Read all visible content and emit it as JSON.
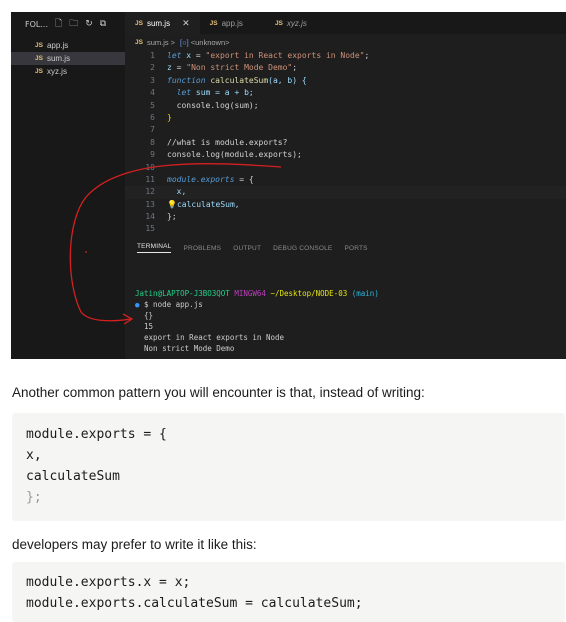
{
  "sidebar": {
    "title": "FOL...",
    "files": [
      {
        "name": "app.js",
        "active": false
      },
      {
        "name": "sum.js",
        "active": true
      },
      {
        "name": "xyz.js",
        "active": false
      }
    ]
  },
  "editor": {
    "tabs": [
      {
        "name": "sum.js",
        "active": true,
        "italic": false
      },
      {
        "name": "app.js",
        "active": false,
        "italic": false
      },
      {
        "name": "xyz.js",
        "active": false,
        "italic": true
      }
    ],
    "breadcrumb": {
      "file": "sum.js",
      "sep": ">",
      "symbol": "<unknown>"
    },
    "line_numbers": [
      "1",
      "2",
      "3",
      "4",
      "5",
      "6",
      "7",
      "8",
      "9",
      "10",
      "11",
      "12",
      "13",
      "14",
      "15"
    ],
    "lines": {
      "l1_kw": "let",
      "l1_var": " x ",
      "l1_op": "= ",
      "l1_str": "\"export in React exports in Node\"",
      "l1_end": ";",
      "l2_var": "z ",
      "l2_op": "= ",
      "l2_str": "\"Non strict Mode Demo\"",
      "l2_end": ";",
      "l3_kw": "function",
      "l3_fn": " calculateSum",
      "l3_rest": "(a, b) {",
      "l4_kw": "let",
      "l4_rest": " sum = a + b;",
      "l5_rest": "console.log(sum);",
      "l6_rest": "}",
      "l8_cm": "//what is module.exports?",
      "l9_rest": "console.log(module.exports);",
      "l11_kw": "module.exports",
      "l11_rest": " = {",
      "l12_rest": "x,",
      "l13_rest": "calculateSum,",
      "l14_rest": "};"
    }
  },
  "panel": {
    "tabs": [
      "TERMINAL",
      "PROBLEMS",
      "OUTPUT",
      "DEBUG CONSOLE",
      "PORTS"
    ]
  },
  "terminal": {
    "user": "Jatin@LAPTOP-J3BO3QOT",
    "shell": "MINGW64",
    "path": "~/Desktop/NODE-03",
    "branch": "(main)",
    "command": "$ node app.js",
    "out1": "{}",
    "out2": "15",
    "out3": "export in React exports in Node",
    "out4": "Non strict Mode Demo"
  },
  "article": {
    "para1": "Another common pattern you will encounter is that, instead of writing:",
    "block1": [
      "module.exports = {",
      "x,",
      "calculateSum",
      "};"
    ],
    "para2": "developers may prefer to write it like this:",
    "block2": [
      "module.exports.x = x;",
      "module.exports.calculateSum = calculateSum;"
    ]
  },
  "colors": {
    "annotation": "#d42020"
  }
}
